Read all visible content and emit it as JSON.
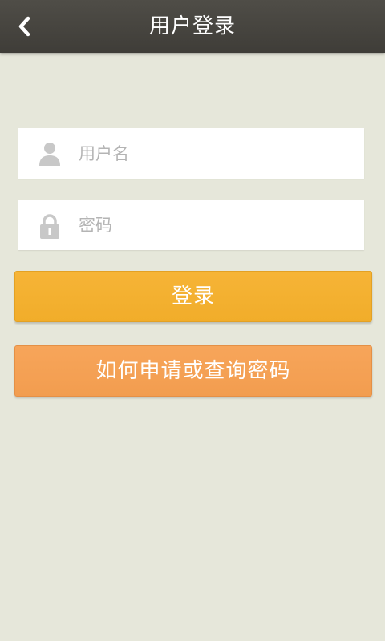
{
  "header": {
    "title": "用户登录",
    "back_icon": "chevron-left-icon"
  },
  "form": {
    "username": {
      "placeholder": "用户名",
      "value": "",
      "icon": "user-icon"
    },
    "password": {
      "placeholder": "密码",
      "value": "",
      "icon": "lock-icon"
    }
  },
  "buttons": {
    "login_label": "登录",
    "help_label": "如何申请或查询密码"
  },
  "colors": {
    "header_bg": "#45433e",
    "page_bg": "#e6e7da",
    "login_button": "#f4b233",
    "help_button": "#f5a354",
    "icon_gray": "#c8c8c8"
  }
}
